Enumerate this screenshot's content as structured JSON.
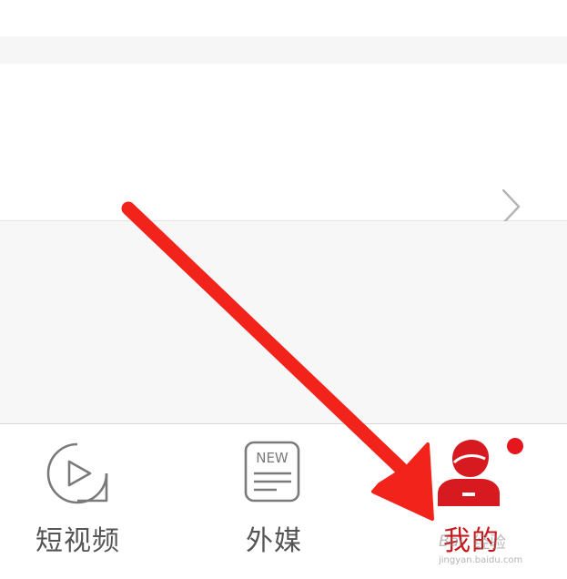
{
  "settings_row": {
    "chevron_icon": "chevron-right-icon"
  },
  "tabbar": {
    "tabs": [
      {
        "label": "短视频",
        "icon": "play-circle-icon",
        "active": false
      },
      {
        "label": "外媒",
        "icon": "news-icon",
        "icon_text": "NEW",
        "active": false
      },
      {
        "label": "我的",
        "icon": "user-avatar-icon",
        "active": true,
        "badge": "red-dot"
      }
    ],
    "active_color": "#c8171c",
    "inactive_color": "#555555"
  },
  "annotation": {
    "arrow_color": "#f2231a",
    "points_to": "我的"
  },
  "watermark": {
    "logo_text": "Bai",
    "text": "经验",
    "url": "jingyan.baidu.com"
  }
}
